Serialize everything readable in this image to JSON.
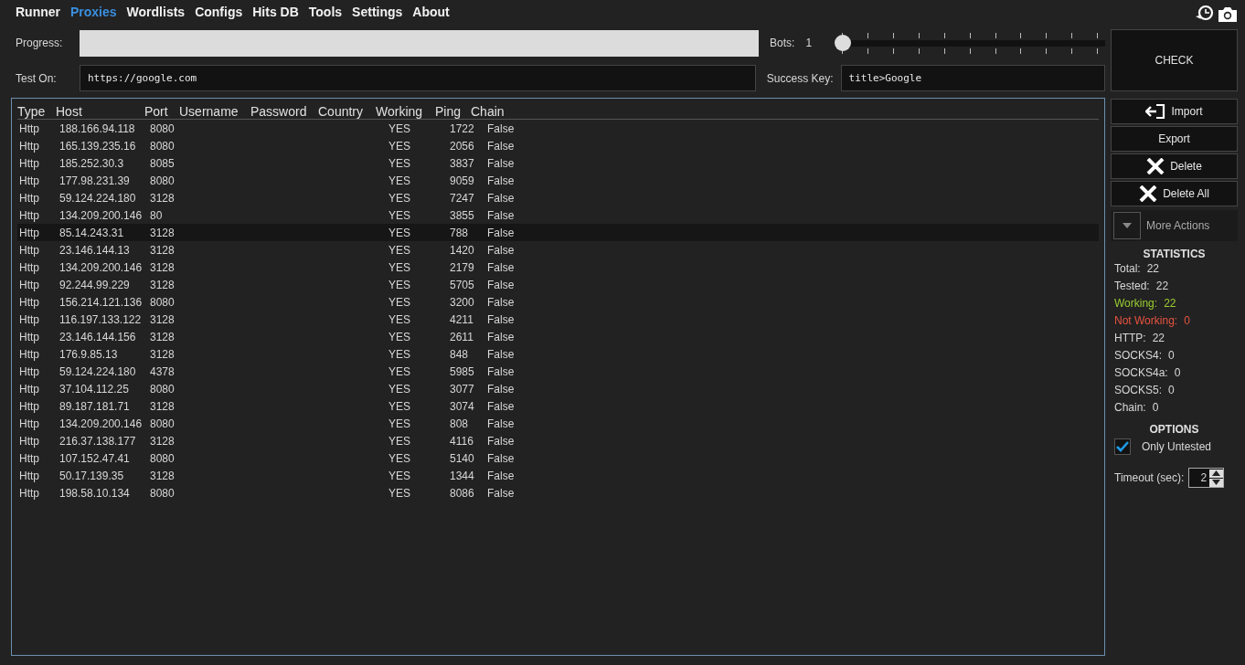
{
  "menu": [
    {
      "label": "Runner",
      "selected": false
    },
    {
      "label": "Proxies",
      "selected": true
    },
    {
      "label": "Wordlists",
      "selected": false
    },
    {
      "label": "Configs",
      "selected": false
    },
    {
      "label": "Hits DB",
      "selected": false
    },
    {
      "label": "Tools",
      "selected": false
    },
    {
      "label": "Settings",
      "selected": false
    },
    {
      "label": "About",
      "selected": false
    }
  ],
  "progress": {
    "label": "Progress:",
    "level": 0
  },
  "bots": {
    "label": "Bots:",
    "value": "1",
    "level": 0
  },
  "check_button": "CHECK",
  "test_on": {
    "label": "Test On:",
    "value": "https://google.com"
  },
  "success_key": {
    "label": "Success Key:",
    "value": "title>Google"
  },
  "table": {
    "columns": [
      "Type",
      "Host",
      "Port",
      "Username",
      "Password",
      "Country",
      "Working",
      "Ping",
      "Chain"
    ],
    "rows": [
      {
        "cells": [
          "Http",
          "188.166.94.118",
          "8080",
          "",
          "",
          "",
          "YES",
          "1722",
          "False"
        ],
        "selected": false
      },
      {
        "cells": [
          "Http",
          "165.139.235.16",
          "8080",
          "",
          "",
          "",
          "YES",
          "2056",
          "False"
        ],
        "selected": false
      },
      {
        "cells": [
          "Http",
          "185.252.30.3",
          "8085",
          "",
          "",
          "",
          "YES",
          "3837",
          "False"
        ],
        "selected": false
      },
      {
        "cells": [
          "Http",
          "177.98.231.39",
          "8080",
          "",
          "",
          "",
          "YES",
          "9059",
          "False"
        ],
        "selected": false
      },
      {
        "cells": [
          "Http",
          "59.124.224.180",
          "3128",
          "",
          "",
          "",
          "YES",
          "7247",
          "False"
        ],
        "selected": false
      },
      {
        "cells": [
          "Http",
          "134.209.200.146",
          "80",
          "",
          "",
          "",
          "YES",
          "3855",
          "False"
        ],
        "selected": false
      },
      {
        "cells": [
          "Http",
          "85.14.243.31",
          "3128",
          "",
          "",
          "",
          "YES",
          "788",
          "False"
        ],
        "selected": true
      },
      {
        "cells": [
          "Http",
          "23.146.144.13",
          "3128",
          "",
          "",
          "",
          "YES",
          "1420",
          "False"
        ],
        "selected": false
      },
      {
        "cells": [
          "Http",
          "134.209.200.146",
          "3128",
          "",
          "",
          "",
          "YES",
          "2179",
          "False"
        ],
        "selected": false
      },
      {
        "cells": [
          "Http",
          "92.244.99.229",
          "3128",
          "",
          "",
          "",
          "YES",
          "5705",
          "False"
        ],
        "selected": false
      },
      {
        "cells": [
          "Http",
          "156.214.121.136",
          "8080",
          "",
          "",
          "",
          "YES",
          "3200",
          "False"
        ],
        "selected": false
      },
      {
        "cells": [
          "Http",
          "116.197.133.122",
          "3128",
          "",
          "",
          "",
          "YES",
          "4211",
          "False"
        ],
        "selected": false
      },
      {
        "cells": [
          "Http",
          "23.146.144.156",
          "3128",
          "",
          "",
          "",
          "YES",
          "2611",
          "False"
        ],
        "selected": false
      },
      {
        "cells": [
          "Http",
          "176.9.85.13",
          "3128",
          "",
          "",
          "",
          "YES",
          "848",
          "False"
        ],
        "selected": false
      },
      {
        "cells": [
          "Http",
          "59.124.224.180",
          "4378",
          "",
          "",
          "",
          "YES",
          "5985",
          "False"
        ],
        "selected": false
      },
      {
        "cells": [
          "Http",
          "37.104.112.25",
          "8080",
          "",
          "",
          "",
          "YES",
          "3077",
          "False"
        ],
        "selected": false
      },
      {
        "cells": [
          "Http",
          "89.187.181.71",
          "3128",
          "",
          "",
          "",
          "YES",
          "3074",
          "False"
        ],
        "selected": false
      },
      {
        "cells": [
          "Http",
          "134.209.200.146",
          "8080",
          "",
          "",
          "",
          "YES",
          "808",
          "False"
        ],
        "selected": false
      },
      {
        "cells": [
          "Http",
          "216.37.138.177",
          "3128",
          "",
          "",
          "",
          "YES",
          "4116",
          "False"
        ],
        "selected": false
      },
      {
        "cells": [
          "Http",
          "107.152.47.41",
          "8080",
          "",
          "",
          "",
          "YES",
          "5140",
          "False"
        ],
        "selected": false
      },
      {
        "cells": [
          "Http",
          "50.17.139.35",
          "3128",
          "",
          "",
          "",
          "YES",
          "1344",
          "False"
        ],
        "selected": false
      },
      {
        "cells": [
          "Http",
          "198.58.10.134",
          "8080",
          "",
          "",
          "",
          "YES",
          "8086",
          "False"
        ],
        "selected": false
      }
    ]
  },
  "actions": [
    {
      "label": "Import",
      "kind": "import"
    },
    {
      "label": "Export",
      "kind": "plain"
    },
    {
      "label": "Delete",
      "kind": "delete"
    },
    {
      "label": "Delete All",
      "kind": "delete"
    }
  ],
  "more_actions": "More Actions",
  "statistics": {
    "title": "STATISTICS",
    "items": [
      {
        "label": "Total:",
        "value": "22",
        "color": "#d8d8d8"
      },
      {
        "label": "Tested:",
        "value": "22",
        "color": "#d8d8d8"
      },
      {
        "label": "Working:",
        "value": "22",
        "color": "#9acd32"
      },
      {
        "label": "Not Working:",
        "value": "0",
        "color": "#e8533f"
      },
      {
        "label": "HTTP:",
        "value": "22",
        "color": "#d8d8d8"
      },
      {
        "label": "SOCKS4:",
        "value": "0",
        "color": "#d8d8d8"
      },
      {
        "label": "SOCKS4a:",
        "value": "0",
        "color": "#d8d8d8"
      },
      {
        "label": "SOCKS5:",
        "value": "0",
        "color": "#d8d8d8"
      },
      {
        "label": "Chain:",
        "value": "0",
        "color": "#d8d8d8"
      }
    ]
  },
  "options": {
    "title": "OPTIONS",
    "only_untested": {
      "label": "Only Untested",
      "checked": true
    },
    "timeout": {
      "label": "Timeout (sec):",
      "value": "2"
    }
  }
}
